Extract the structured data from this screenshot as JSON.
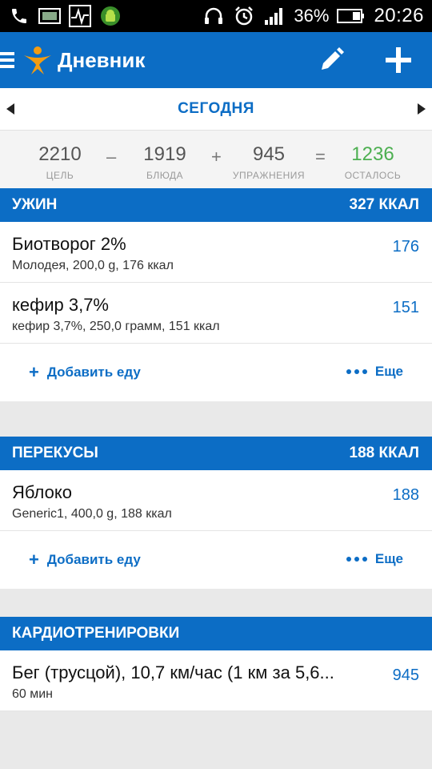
{
  "status_bar": {
    "battery": "36%",
    "time": "20:26",
    "icons_left": [
      "phone-icon",
      "image-icon",
      "activity-monitor-icon",
      "android-shield-icon"
    ],
    "icons_right": [
      "headset-icon",
      "alarm-icon",
      "signal-icon",
      "battery-icon"
    ]
  },
  "app_bar": {
    "title": "Дневник",
    "actions": [
      "edit-icon",
      "add-icon"
    ]
  },
  "date_nav": {
    "label": "СЕГОДНЯ"
  },
  "summary": {
    "goal": {
      "value": "2210",
      "label": "ЦЕЛЬ"
    },
    "food": {
      "value": "1919",
      "label": "БЛЮДА"
    },
    "exercise": {
      "value": "945",
      "label": "УПРАЖНЕНИЯ"
    },
    "remaining": {
      "value": "1236",
      "label": "ОСТАЛОСЬ"
    },
    "op_minus": "–",
    "op_plus": "+",
    "op_equals": "="
  },
  "sections": {
    "dinner": {
      "title": "УЖИН",
      "kcal": "327 ККАЛ",
      "items": [
        {
          "name": "Биотворог 2%",
          "desc": "Молодея, 200,0 g, 176 ккал",
          "cal": "176"
        },
        {
          "name": "кефир 3,7%",
          "desc": "кефир 3,7%, 250,0 грамм, 151 ккал",
          "cal": "151"
        }
      ],
      "add_label": "Добавить еду",
      "more_label": "Еще"
    },
    "snacks": {
      "title": "ПЕРЕКУСЫ",
      "kcal": "188 ККАЛ",
      "items": [
        {
          "name": "Яблоко",
          "desc": "Generic1, 400,0 g, 188 ккал",
          "cal": "188"
        }
      ],
      "add_label": "Добавить еду",
      "more_label": "Еще"
    },
    "cardio": {
      "title": "КАРДИОТРЕНИРОВКИ",
      "items": [
        {
          "name": "Бег (трусцой), 10,7 км/час (1 км за 5,6...",
          "desc": "60 мин",
          "cal": "945"
        }
      ]
    }
  },
  "colors": {
    "primary": "#0c6dc5",
    "remaining_green": "#4caf50",
    "background": "#e9e9e9"
  }
}
